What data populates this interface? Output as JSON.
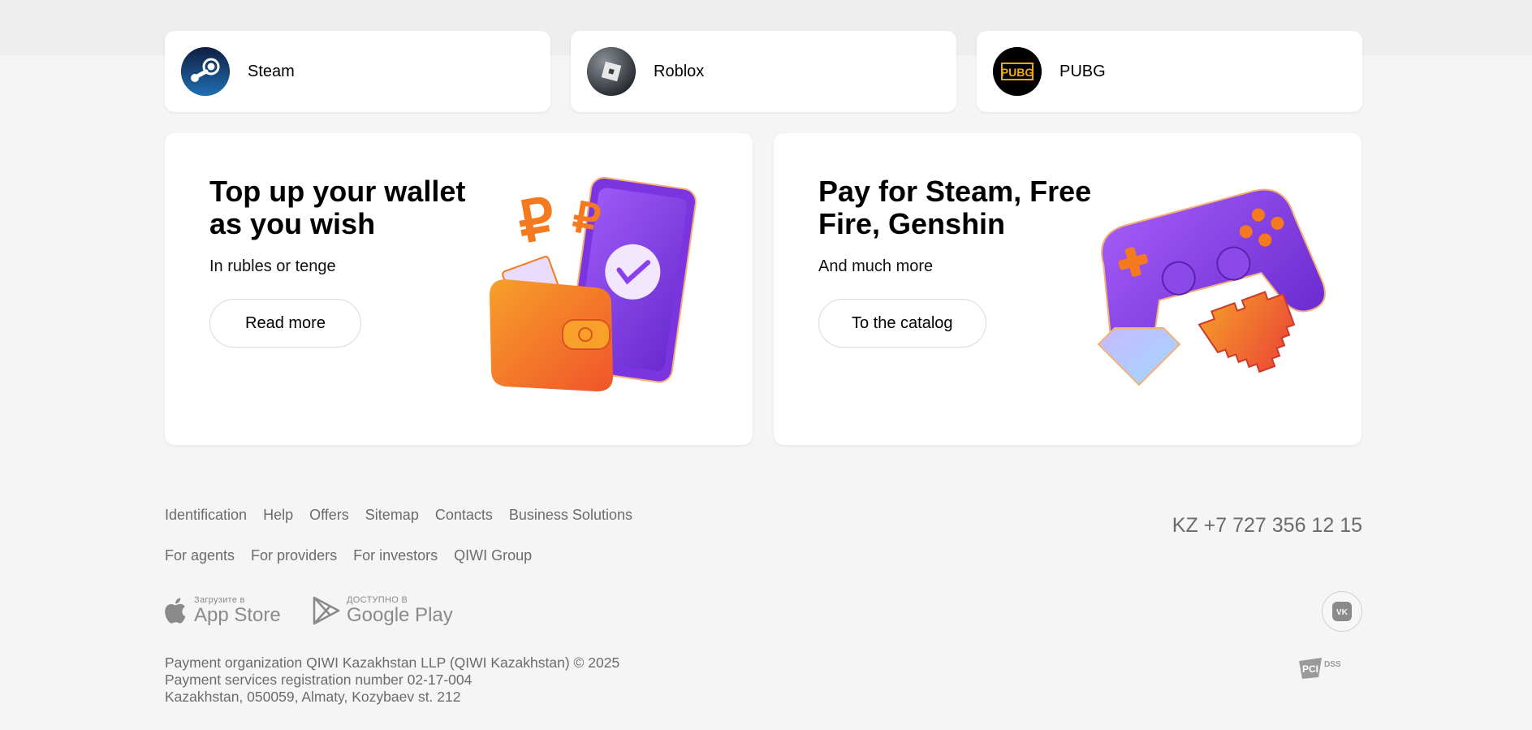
{
  "services": [
    {
      "name": "Steam",
      "icon": "steam-logo-icon",
      "color": "#1b2f62"
    },
    {
      "name": "Roblox",
      "icon": "roblox-logo-icon",
      "color": "#3a3f45"
    },
    {
      "name": "PUBG",
      "icon": "pubg-logo-icon",
      "color": "#f2a900",
      "logo_text": "PUBG"
    }
  ],
  "promos": [
    {
      "title": "Top up your wallet as you wish",
      "subtitle": "In rubles or tenge",
      "button": "Read more",
      "art": "wallet-phone-illustration"
    },
    {
      "title": "Pay for Steam, Free Fire, Genshin",
      "subtitle": "And much more",
      "button": "To the catalog",
      "art": "gamepad-illustration"
    }
  ],
  "footer": {
    "links_row1": [
      "Identification",
      "Help",
      "Offers",
      "Sitemap",
      "Contacts",
      "Business Solutions"
    ],
    "links_row2": [
      "For agents",
      "For providers",
      "For investors",
      "QIWI Group"
    ],
    "phone": "KZ +7 727 356 12 15",
    "app_store": {
      "small": "Загрузите в",
      "big": "App Store"
    },
    "google_play": {
      "small": "ДОСТУПНО В",
      "big": "Google Play"
    },
    "vk_label": "VK",
    "legal": [
      "Payment organization QIWI Kazakhstan LLP (QIWI Kazakhstan) © 2025",
      "Payment services registration number 02-17-004",
      "Kazakhstan, 050059, Almaty, Kozybaev st. 212"
    ],
    "pci": {
      "main": "PCI",
      "sub": "DSS"
    }
  },
  "colors": {
    "background": "#f5f5f5",
    "card": "#ffffff",
    "text_muted": "#6b6b6b",
    "accent_purple": "#8a3ff0",
    "accent_orange": "#f57a1f"
  }
}
